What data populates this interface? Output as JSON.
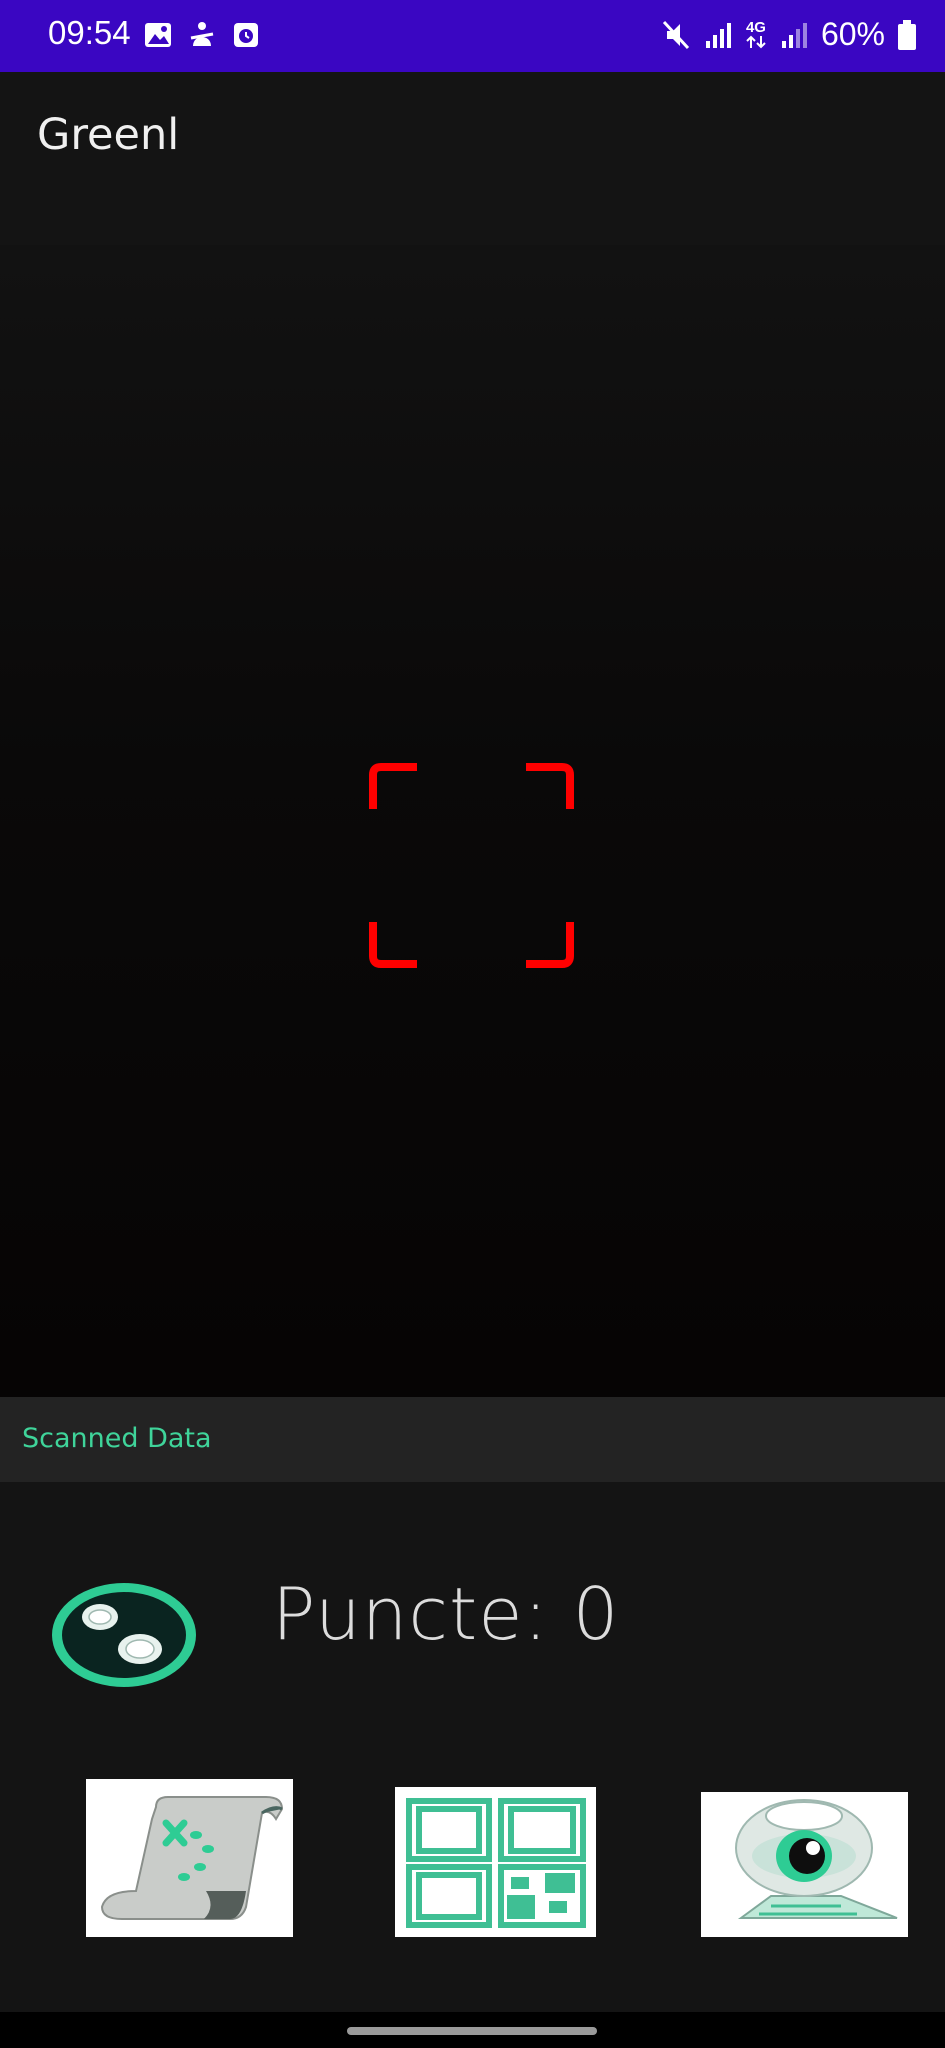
{
  "status_bar": {
    "time": "09:54",
    "battery_percent": "60%",
    "network_label": "4G",
    "icons": [
      "gallery-icon",
      "accessibility-icon",
      "clock-app-icon",
      "mute-icon",
      "signal-icon",
      "signal-icon",
      "battery-icon"
    ],
    "background_color": "#3a06c2"
  },
  "app_bar": {
    "title": "Greenl"
  },
  "scanner": {
    "frame_color": "#ff0000"
  },
  "scanned_data": {
    "label": "Scanned Data",
    "label_color": "#3fd49a"
  },
  "points": {
    "text": "Puncte: 0"
  },
  "menu_tiles": [
    {
      "icon": "treasure-map-icon"
    },
    {
      "icon": "qr-code-icon"
    },
    {
      "icon": "eye-camera-icon"
    }
  ],
  "accent_color": "#2ecc94"
}
